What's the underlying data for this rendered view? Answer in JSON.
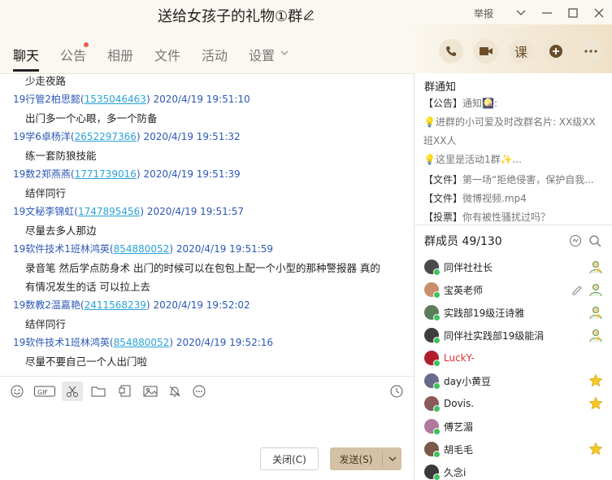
{
  "window": {
    "title": "送给女孩子的礼物①群",
    "report_label": "举报"
  },
  "tabs": [
    {
      "label": "聊天",
      "active": true
    },
    {
      "label": "公告"
    },
    {
      "label": "相册"
    },
    {
      "label": "文件"
    },
    {
      "label": "活动"
    },
    {
      "label": "设置"
    }
  ],
  "actions": {
    "course_label": "课"
  },
  "chat": {
    "messages": [
      {
        "type": "body",
        "text": "少走夜路"
      },
      {
        "type": "header",
        "sender": "19行管2柏思懿",
        "qq": "1535046463",
        "time": "2020/4/19 19:51:10"
      },
      {
        "type": "body",
        "text": "出门多一个心眼，多一个防备"
      },
      {
        "type": "header",
        "sender": "19学6卓杨洋",
        "qq": "2652297366",
        "time": "2020/4/19 19:51:32"
      },
      {
        "type": "body",
        "text": "练一套防狼技能"
      },
      {
        "type": "header",
        "sender": "19数2郑燕燕",
        "qq": "1771739016",
        "time": "2020/4/19 19:51:39"
      },
      {
        "type": "body",
        "text": "结伴同行"
      },
      {
        "type": "header",
        "sender": "19文秘李锦虹",
        "qq": "1747895456",
        "time": "2020/4/19 19:51:57"
      },
      {
        "type": "body",
        "text": "尽量去多人那边"
      },
      {
        "type": "header",
        "sender": "19软件技术1班林鸿英",
        "qq": "854880052",
        "time": "2020/4/19 19:51:59"
      },
      {
        "type": "body",
        "text": "录音笔 然后学点防身术 出门的时候可以在包包上配一个小型的那种警报器 真的"
      },
      {
        "type": "body",
        "text": "有情况发生的话 可以拉上去"
      },
      {
        "type": "header",
        "sender": "19数教2温嘉艳",
        "qq": "2411568239",
        "time": "2020/4/19 19:52:02"
      },
      {
        "type": "body",
        "text": "结伴同行"
      },
      {
        "type": "header",
        "sender": "19软件技术1班林鸿英",
        "qq": "854880052",
        "time": "2020/4/19 19:52:16"
      },
      {
        "type": "body",
        "text": "尽量不要自己一个人出门啦"
      }
    ]
  },
  "buttons": {
    "close": "关闭(C)",
    "send": "发送(S)"
  },
  "notice": {
    "title": "群通知",
    "lines": [
      {
        "tag": "【公告】",
        "text": "通知🎑:"
      },
      {
        "tag": "",
        "text": "💡进群的小可爱及时改群名片: XX级XX"
      },
      {
        "tag": "",
        "text": "班XX人"
      },
      {
        "tag": "",
        "text": "💡这里是活动1群✨..."
      },
      {
        "tag": "【文件】",
        "text": "第一场“拒绝侵害，保护自我..."
      },
      {
        "tag": "【文件】",
        "text": "微博视频.mp4"
      },
      {
        "tag": "【投票】",
        "text": "你有被性骚扰过吗？"
      }
    ]
  },
  "members": {
    "title": "群成员 49/130",
    "list": [
      {
        "name": "同伴社社长",
        "badge": "admin"
      },
      {
        "name": "宝英老师",
        "badge": "owner"
      },
      {
        "name": "实践部19级汪诗雅",
        "badge": "admin"
      },
      {
        "name": "同伴社实践部19级能涓",
        "badge": "admin"
      },
      {
        "name": "LuckY-",
        "badge": "",
        "red": true
      },
      {
        "name": "day小黄豆",
        "badge": "star"
      },
      {
        "name": "Dovis.",
        "badge": "star"
      },
      {
        "name": "傅艺湄",
        "badge": ""
      },
      {
        "name": "胡毛毛",
        "badge": "star"
      },
      {
        "name": "久念i",
        "badge": ""
      }
    ]
  },
  "colors": {
    "accent": "#2c58b7",
    "link": "#2aa3d8",
    "send": "#d3c2a5"
  }
}
